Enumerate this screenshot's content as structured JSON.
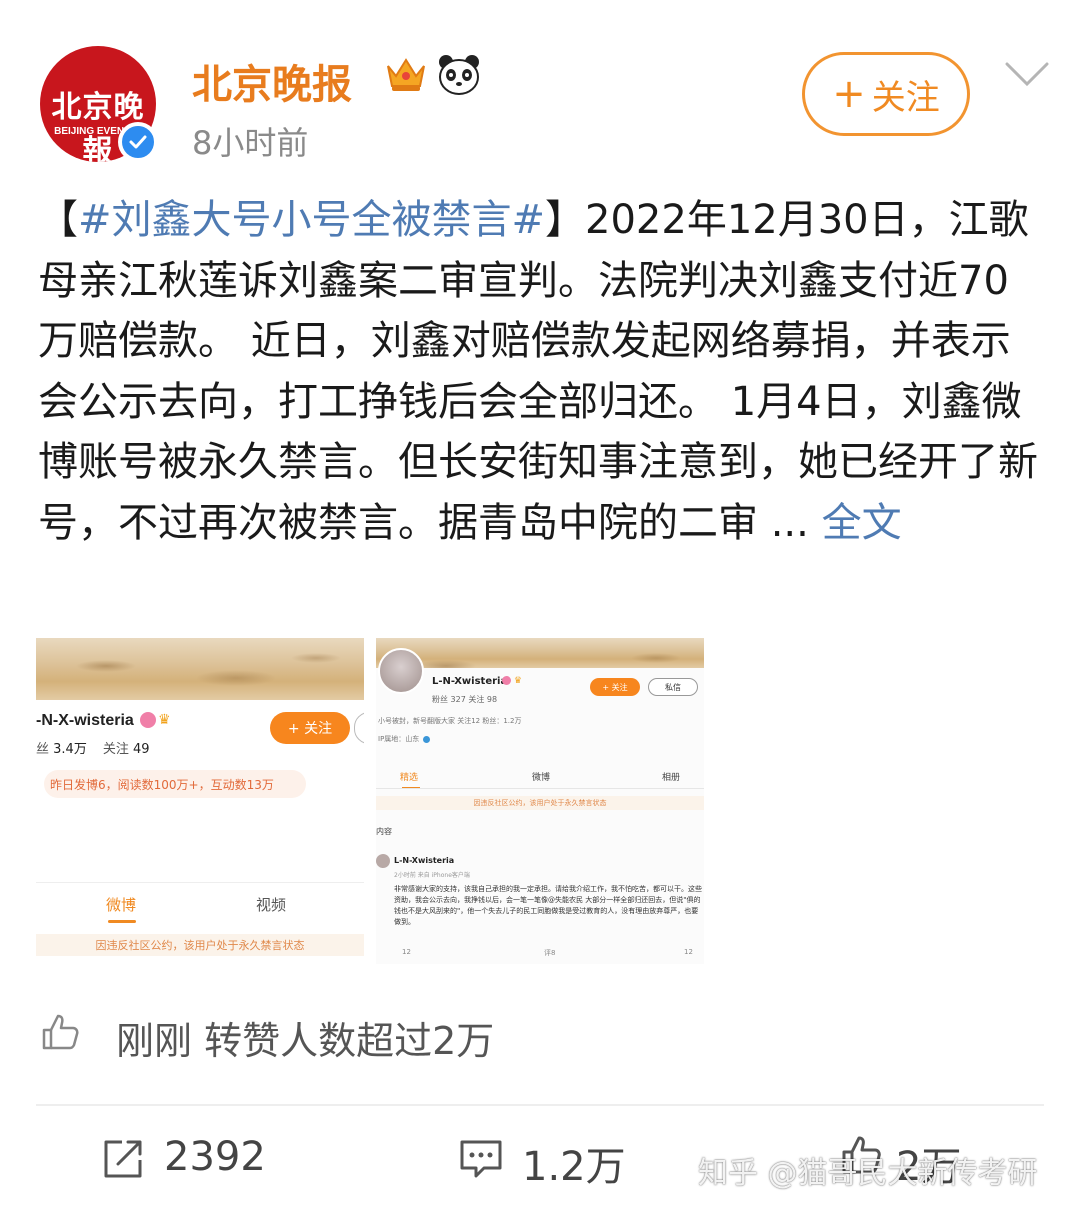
{
  "header": {
    "avatar_text": "北京晚報",
    "avatar_subtext": "BEIJING EVENING",
    "user_name": "北京晚报",
    "time": "8小时前",
    "follow_label": "关注",
    "follow_plus": "+",
    "accent": "#f08a22",
    "name_color": "#e87c1e"
  },
  "post": {
    "bracket_open": "【",
    "hashtag": "#刘鑫大号小号全被禁言#",
    "bracket_close": "】",
    "body": "2022年12月30日，江歌母亲江秋莲诉刘鑫案二审宣判。法院判决刘鑫支付近70万赔偿款。 近日，刘鑫对赔偿款发起网络募捐，并表示会公示去向，打工挣钱后会全部归还。 1月4日，刘鑫微博账号被永久禁言。但长安街知事注意到，她已经开了新号，不过再次被禁言。据青岛中院的二审 ...",
    "more_label": "全文",
    "link_color": "#4f7bb3"
  },
  "image_a": {
    "name": "-N-X-wisteria",
    "fans_label": "丝",
    "fans_count": "3.4万",
    "follow_label": "关注",
    "follow_count": "49",
    "follow_btn": "+ 关注",
    "highlight": "昨日发博6，阅读数100万+，互动数13万",
    "tab_weibo": "微博",
    "tab_video": "视频",
    "notice": "因违反社区公约，该用户处于永久禁言状态"
  },
  "image_b": {
    "name": "L-N-Xwisteria",
    "stats": "粉丝 327   关注 98",
    "follow_btn": "+ 关注",
    "msg_btn": "私信",
    "bio": "小号被封，新号翻版大家 关注12 粉丝：1.2万",
    "location": "IP属地：山东",
    "tab_1": "精选",
    "tab_2": "微博",
    "tab_3": "相册",
    "notice": "因违反社区公约，该用户处于永久禁言状态",
    "section": "内容",
    "post_name": "L-N-Xwisteria",
    "post_meta": "2小时前  来自 iPhone客户端",
    "post_text": "非常感谢大家的支持，该我自己承担的我一定承担。请给我介绍工作，我不怕吃苦，都可以干。这些资助，我会公示去向，我挣钱以后，会一笔一笔像@失能农民 大部分一样全部归还回去，但说\"俱的钱也不是大风刮来的\"，他一个失去儿子的民工同胞做我是受过教育的人，没有理由放弃尊严，也要做到。",
    "action_repost": "12",
    "action_comment": "评8",
    "action_like": "12"
  },
  "repost_notice": "刚刚 转赞人数超过2万",
  "footer": {
    "share_count": "2392",
    "comment_count": "1.2万",
    "like_count": "2万",
    "watermark": "知乎 @猫哥民大新传考研"
  }
}
